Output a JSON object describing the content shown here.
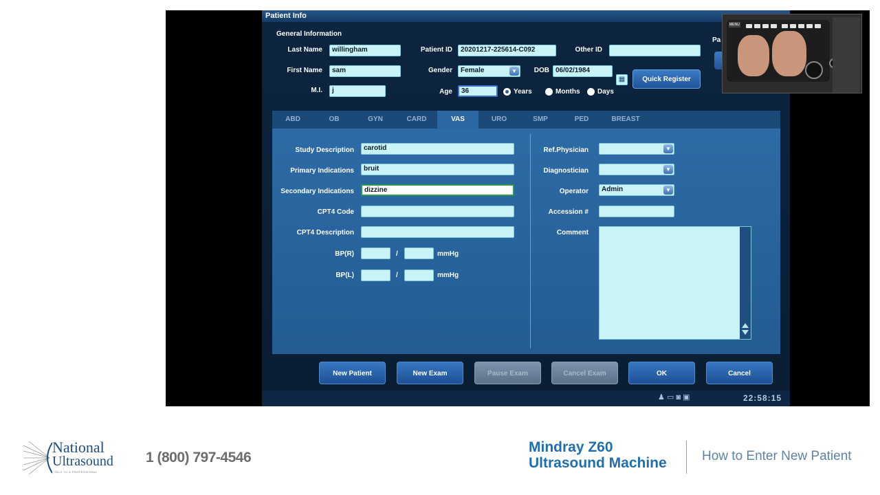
{
  "window": {
    "title": "Patient Info"
  },
  "general": {
    "heading": "General Information",
    "last_name_label": "Last Name",
    "last_name": "willingham",
    "first_name_label": "First Name",
    "first_name": "sam",
    "mi_label": "M.I.",
    "mi": "j",
    "patient_id_label": "Patient ID",
    "patient_id": "20201217-225614-C092",
    "gender_label": "Gender",
    "gender": "Female",
    "age_label": "Age",
    "age": "36",
    "age_units": [
      "Years",
      "Months",
      "Days"
    ],
    "age_unit_selected": "Years",
    "other_id_label": "Other ID",
    "other_id": "",
    "dob_label": "DOB",
    "dob": "06/02/1984",
    "partial_label": "Pa",
    "quick_register": "Quick Register"
  },
  "tabs": [
    "ABD",
    "OB",
    "GYN",
    "CARD",
    "VAS",
    "URO",
    "SMP",
    "PED",
    "BREAST"
  ],
  "active_tab": "VAS",
  "study": {
    "study_description_label": "Study Description",
    "study_description": "carotid",
    "primary_indications_label": "Primary Indications",
    "primary_indications": "bruit",
    "secondary_indications_label": "Secondary Indications",
    "secondary_indications": "dizzine",
    "cpt4_code_label": "CPT4 Code",
    "cpt4_code": "",
    "cpt4_description_label": "CPT4 Description",
    "cpt4_description": "",
    "bpr_label": "BP(R)",
    "bpl_label": "BP(L)",
    "slash": "/",
    "unit": "mmHg",
    "ref_physician_label": "Ref.Physician",
    "ref_physician": "",
    "diagnostician_label": "Diagnostician",
    "diagnostician": "",
    "operator_label": "Operator",
    "operator": "Admin",
    "accession_label": "Accession #",
    "accession": "",
    "comment_label": "Comment",
    "comment": ""
  },
  "buttons": {
    "new_patient": "New Patient",
    "new_exam": "New Exam",
    "pause_exam": "Pause Exam",
    "cancel_exam": "Cancel Exam",
    "ok": "OK",
    "cancel": "Cancel"
  },
  "status": {
    "time": "22:58:15"
  },
  "footer": {
    "logo_line1": "National",
    "logo_line2": "Ultrasound",
    "logo_tagline": "TALK TO A PROFESSIONAL",
    "phone": "1 (800) 797-4546",
    "title_line1": "Mindray Z60",
    "title_line2": "Ultrasound Machine",
    "subtitle": "How to Enter New Patient"
  },
  "pip": {
    "key_label": "MENU"
  }
}
